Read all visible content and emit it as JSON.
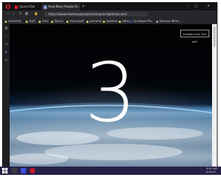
{
  "browser": {
    "tabs": [
      {
        "label": "Speed Dial"
      },
      {
        "label": "How Many People A..."
      }
    ],
    "address": {
      "url": "https://www.howmanypeopleareinspacerightnow.com/"
    },
    "bookmarks": [
      {
        "label": "Unsorted"
      },
      {
        "label": "stuff"
      },
      {
        "label": "misc"
      },
      {
        "label": "Dance"
      },
      {
        "label": "microstuff"
      },
      {
        "label": "personal"
      },
      {
        "label": "bodman"
      },
      {
        "label": "other"
      },
      {
        "label": "Facebook Priv..."
      },
      {
        "label": "Remove Wind..."
      }
    ]
  },
  "page": {
    "download_button": "DOWNLOAD THE APP",
    "count": "3"
  },
  "taskbar": {
    "time": "8:01 AM",
    "date": "2018-07-"
  },
  "colors": {
    "opera_red": "#d91a2a",
    "taskbar": "#252047",
    "space": "#000000"
  }
}
